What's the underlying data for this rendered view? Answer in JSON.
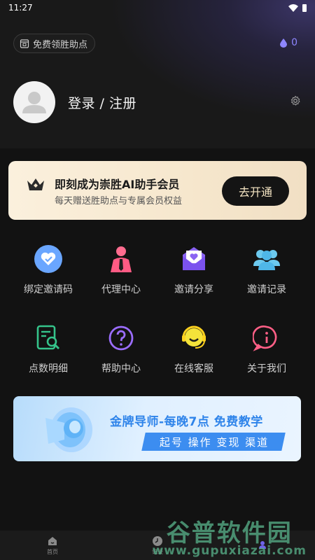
{
  "status_bar": {
    "time": "11:27"
  },
  "header": {
    "points_chip_label": "免费领胜助点",
    "balance": "0",
    "login_label": "登录 / 注册"
  },
  "vip": {
    "title": "即刻成为崇胜AI助手会员",
    "subtitle": "每天赠送胜助点与专属会员权益",
    "button_label": "去开通"
  },
  "grid": {
    "items": [
      {
        "label": "绑定邀请码",
        "icon": "heart-badge-icon"
      },
      {
        "label": "代理中心",
        "icon": "agent-person-icon"
      },
      {
        "label": "邀请分享",
        "icon": "envelope-heart-icon"
      },
      {
        "label": "邀请记录",
        "icon": "people-group-icon"
      },
      {
        "label": "点数明细",
        "icon": "document-search-icon"
      },
      {
        "label": "帮助中心",
        "icon": "question-circle-icon"
      },
      {
        "label": "在线客服",
        "icon": "headset-smile-icon"
      },
      {
        "label": "关于我们",
        "icon": "info-bubble-icon"
      }
    ]
  },
  "banner": {
    "title": "金牌导师-每晚7点 免费教学",
    "subtitle": "起号 操作 变现 渠道"
  },
  "bottom_nav": {
    "items": [
      {
        "label": "首页",
        "icon": "home-icon"
      },
      {
        "label": "记录",
        "icon": "clock-icon"
      },
      {
        "label": "",
        "icon": "profile-icon"
      }
    ]
  },
  "watermark": {
    "line1": "谷普软件园",
    "line2": "www.gupuxiazai.com"
  },
  "colors": {
    "background": "#121212",
    "accent_purple": "#8e86ff",
    "vip_gold": "#f6e7cd",
    "banner_blue": "#3c8df0"
  }
}
